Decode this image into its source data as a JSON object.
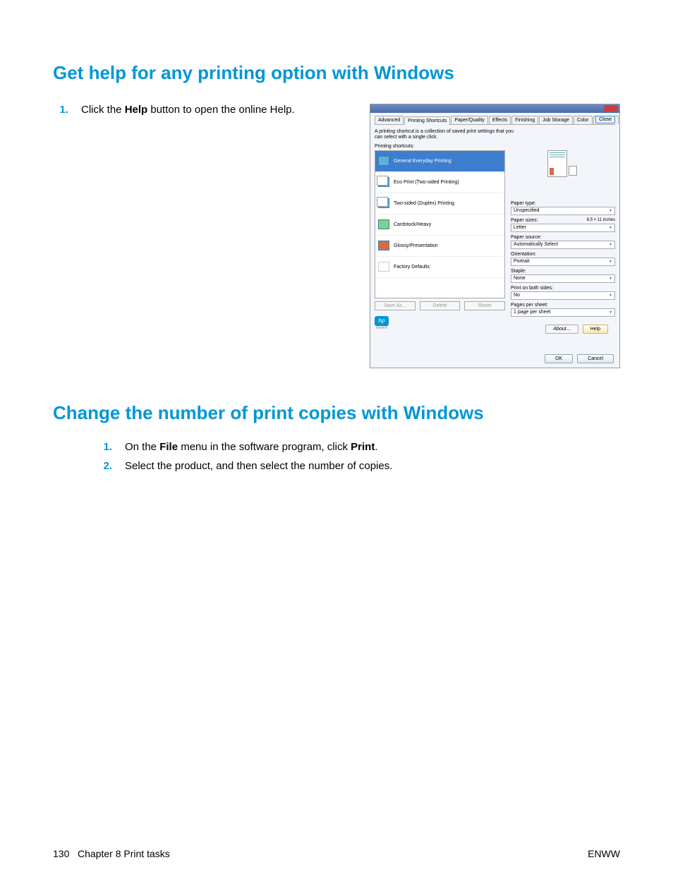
{
  "section1": {
    "heading": "Get help for any printing option with Windows",
    "steps": [
      {
        "num": "1.",
        "prefix": "Click the ",
        "bold": "Help",
        "suffix": " button to open the online Help."
      }
    ]
  },
  "dialog": {
    "tabs": [
      "Advanced",
      "Printing Shortcuts",
      "Paper/Quality",
      "Effects",
      "Finishing",
      "Job Storage",
      "Color",
      "Services"
    ],
    "close_label": "Close",
    "description": "A printing shortcut is a collection of saved print settings that you can select with a single click.",
    "shortcuts_label": "Printing shortcuts:",
    "shortcuts": [
      "General Everyday Printing",
      "Eco Print (Two-sided Printing)",
      "Two-sided (Duplex) Printing",
      "Cardstock/Heavy",
      "Glossy/Presentation",
      "Factory Defaults"
    ],
    "buttons": {
      "save_as": "Save As...",
      "delete": "Delete",
      "reset": "Reset"
    },
    "fields": {
      "paper_type": {
        "label": "Paper type:",
        "value": "Unspecified"
      },
      "paper_sizes": {
        "label": "Paper sizes:",
        "note": "8.5 × 11 inches",
        "value": "Letter"
      },
      "paper_source": {
        "label": "Paper source:",
        "value": "Automatically Select"
      },
      "orientation": {
        "label": "Orientation:",
        "value": "Portrait"
      },
      "staple": {
        "label": "Staple:",
        "value": "None"
      },
      "print_both": {
        "label": "Print on both sides:",
        "value": "No"
      },
      "pages_per_sheet": {
        "label": "Pages per sheet:",
        "value": "1 page per sheet"
      }
    },
    "about_btn": "About...",
    "help_btn": "Help",
    "ok_btn": "OK",
    "cancel_btn": "Cancel",
    "hp_label": "invent"
  },
  "section2": {
    "heading": "Change the number of print copies with Windows",
    "steps": [
      {
        "num": "1.",
        "text_parts": [
          "On the ",
          "File",
          " menu in the software program, click ",
          "Print",
          "."
        ]
      },
      {
        "num": "2.",
        "text": "Select the product, and then select the number of copies."
      }
    ]
  },
  "footer": {
    "left_page": "130",
    "left_text": "Chapter 8   Print tasks",
    "right": "ENWW"
  }
}
